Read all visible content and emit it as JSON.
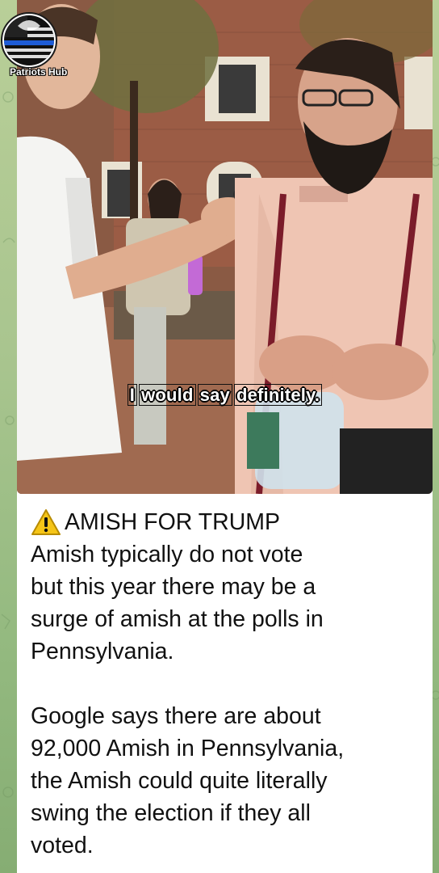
{
  "channel": {
    "name": "Patriots Hub",
    "logo_icon": "thin-blue-line-flag-icon"
  },
  "video": {
    "caption_words": [
      "I",
      "would",
      "say",
      "definitely."
    ]
  },
  "post": {
    "warning_icon": "warning-icon",
    "headline": "AMISH FOR TRUMP",
    "paragraph1": "Amish typically do not vote\nbut this year there may be a\nsurge of amish at the polls in\nPennsylvania.",
    "paragraph2": "Google says there are about\n92,000 Amish in Pennsylvania,\nthe Amish could quite literally\nswing the election if they all\nvoted."
  },
  "colors": {
    "background": "#a9c58f",
    "card": "#ffffff",
    "text": "#111111",
    "warning": "#f5c518"
  }
}
